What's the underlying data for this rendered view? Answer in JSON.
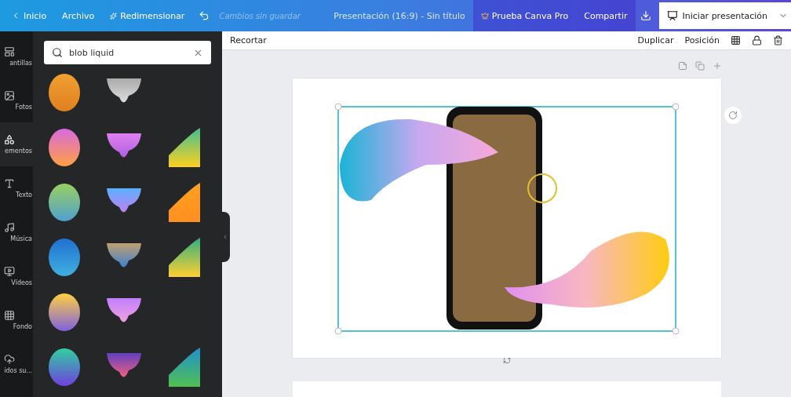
{
  "topbar": {
    "back_label": "Inicio",
    "file_label": "Archivo",
    "resize_label": "Redimensionar",
    "status": "Cambios sin guardar",
    "title": "Presentación (16:9) - Sin título",
    "pro_label": "Prueba Canva Pro",
    "share_label": "Compartir",
    "present_label": "Iniciar presentación"
  },
  "rail": [
    {
      "label": "antillas",
      "selected": false
    },
    {
      "label": "Fotos",
      "selected": false
    },
    {
      "label": "ementos",
      "selected": true
    },
    {
      "label": "Texto",
      "selected": false
    },
    {
      "label": "Música",
      "selected": false
    },
    {
      "label": "Vídeos",
      "selected": false
    },
    {
      "label": "Fondo",
      "selected": false
    },
    {
      "label": "idos su...",
      "selected": false
    }
  ],
  "search": {
    "value": "blob liquid"
  },
  "toolbar": {
    "left": [
      "Recortar"
    ],
    "right": [
      "Duplicar",
      "Posición"
    ]
  }
}
